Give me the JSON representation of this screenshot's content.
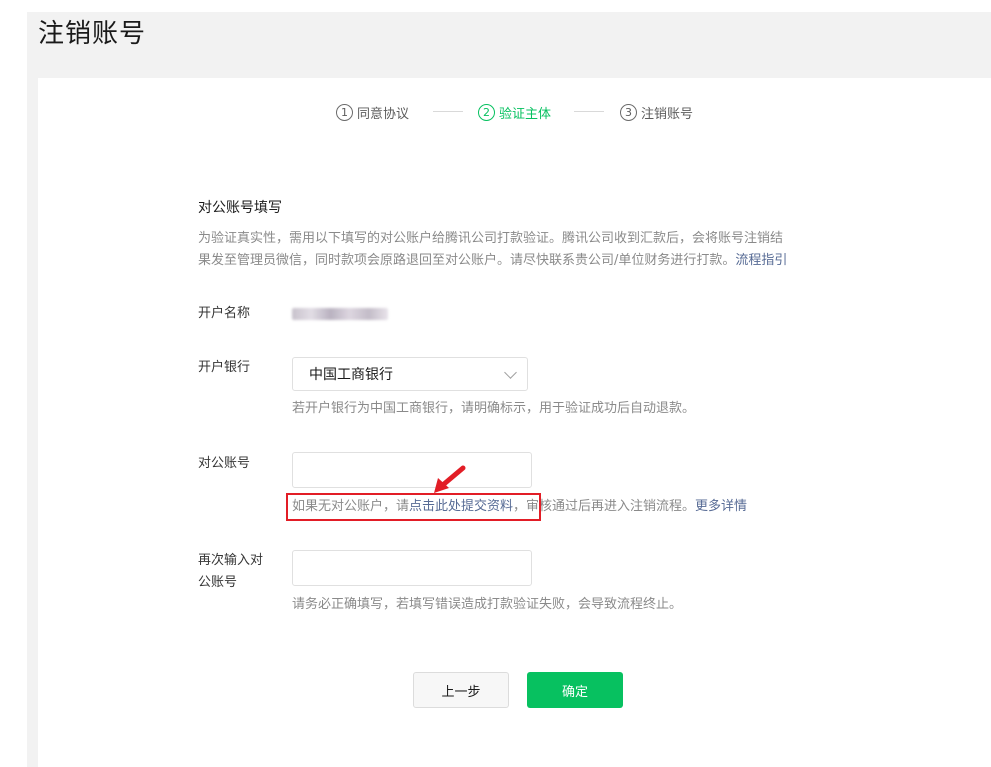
{
  "page": {
    "title": "注销账号"
  },
  "steps": [
    {
      "num": "1",
      "label": "同意协议"
    },
    {
      "num": "2",
      "label": "验证主体"
    },
    {
      "num": "3",
      "label": "注销账号"
    }
  ],
  "colors": {
    "accent": "#07c160",
    "link": "#576b95",
    "highlight": "#e21d26"
  },
  "section": {
    "title": "对公账号填写",
    "desc_line1": "为验证真实性，需用以下填写的对公账户给腾讯公司打款验证。腾讯公司收到汇款后，会将账号注销结",
    "desc_line2": "果发至管理员微信，同时款项会原路退回至对公账户。请尽快联系贵公司/单位财务进行打款。",
    "desc_link": "流程指引"
  },
  "form": {
    "account_name": {
      "label": "开户名称"
    },
    "bank": {
      "label": "开户银行",
      "selected": "中国工商银行",
      "hint": "若开户银行为中国工商银行，请明确标示，用于验证成功后自动退款。"
    },
    "account_number": {
      "label": "对公账号",
      "value": "",
      "hint_prefix": "如果无对公账户，请",
      "hint_link": "点击此处提交资料",
      "hint_suffix": "，审核通过后再进入注销流程。",
      "more_link": "更多详情"
    },
    "confirm_number": {
      "label_line1": "再次输入对",
      "label_line2": "公账号",
      "value": "",
      "hint": "请务必正确填写，若填写错误造成打款验证失败，会导致流程终止。"
    }
  },
  "buttons": {
    "prev": "上一步",
    "confirm": "确定"
  }
}
